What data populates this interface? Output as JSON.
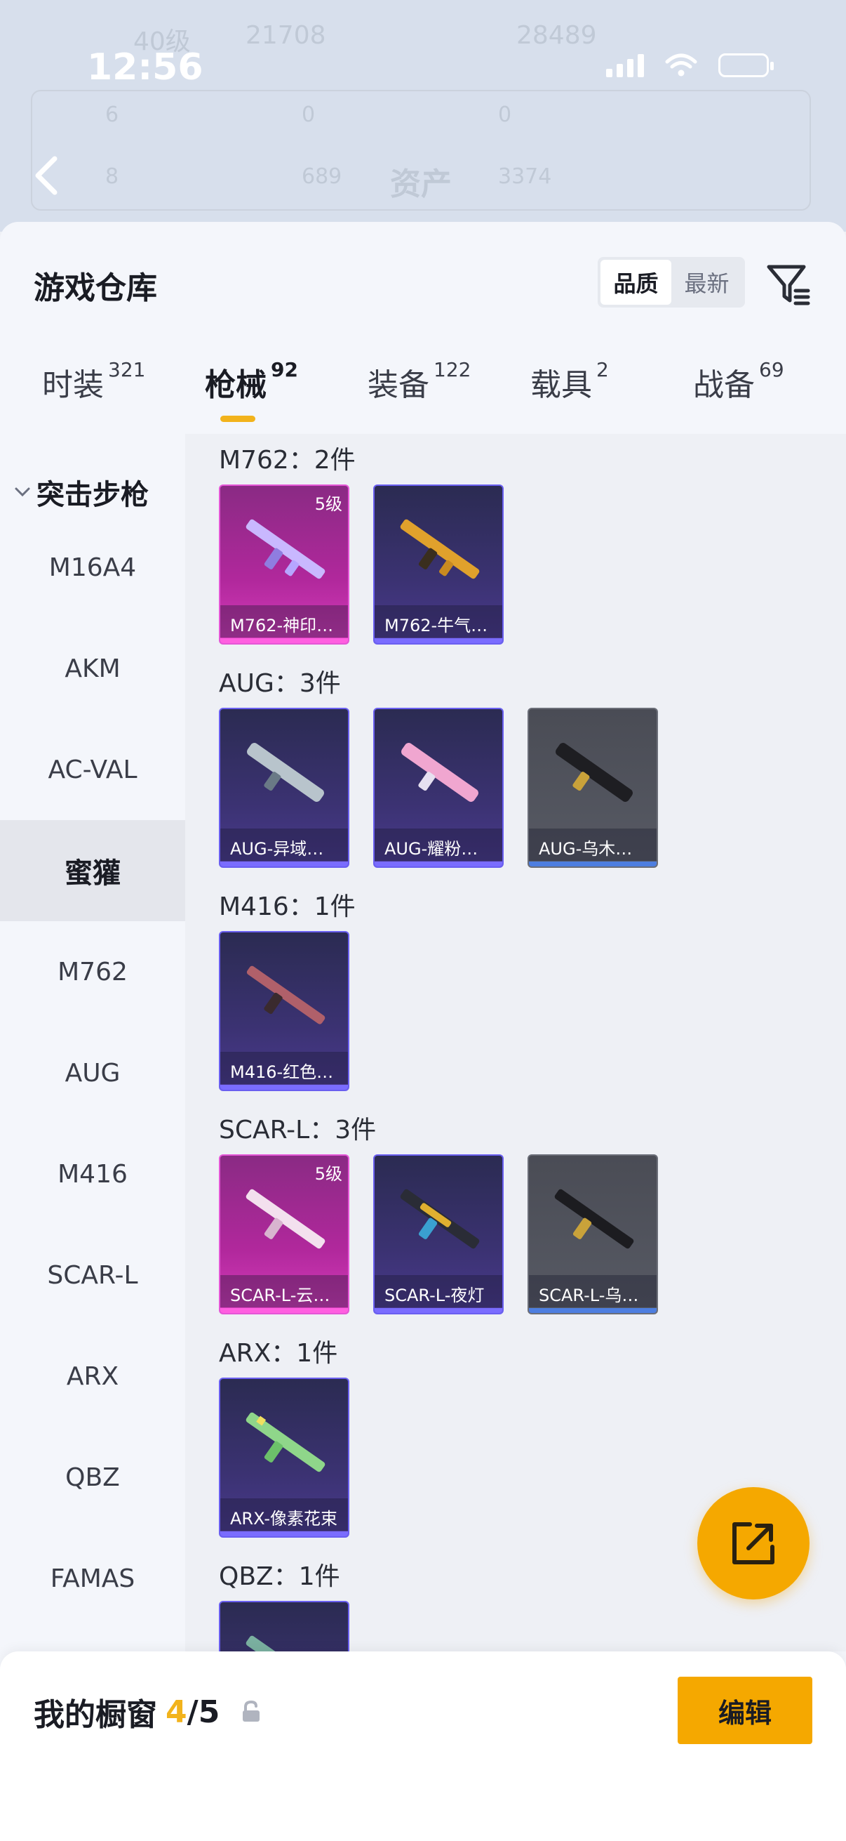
{
  "status": {
    "time": "12:56"
  },
  "background": {
    "ghost_level": "40级",
    "ghost_views": "21708",
    "ghost_score": "28489",
    "ghost_row1": [
      "6",
      "0",
      "0"
    ],
    "ghost_row2": [
      "8",
      "689",
      "3374"
    ],
    "ghost_title": "资产"
  },
  "sheet": {
    "title": "游戏仓库",
    "sort_options": [
      "品质",
      "最新"
    ],
    "active_sort": "品质"
  },
  "tabs": [
    {
      "label": "时装",
      "count": "321"
    },
    {
      "label": "枪械",
      "count": "92"
    },
    {
      "label": "装备",
      "count": "122"
    },
    {
      "label": "载具",
      "count": "2"
    },
    {
      "label": "战备",
      "count": "69"
    }
  ],
  "active_tab": "枪械",
  "sidenav": {
    "group": "突击步枪",
    "items": [
      "M16A4",
      "AKM",
      "AC-VAL",
      "蜜獾",
      "M762",
      "AUG",
      "M416",
      "SCAR-L",
      "ARX",
      "QBZ",
      "FAMAS"
    ],
    "active": "蜜獾"
  },
  "groups": [
    {
      "title": "M762：2件",
      "items": [
        {
          "name": "M762-神印…",
          "rarity": "pink",
          "level": "5级"
        },
        {
          "name": "M762-牛气…",
          "rarity": "purple",
          "level": ""
        }
      ]
    },
    {
      "title": "AUG：3件",
      "items": [
        {
          "name": "AUG-异域银装",
          "rarity": "purple",
          "level": ""
        },
        {
          "name": "AUG-耀粉歌者",
          "rarity": "purple",
          "level": ""
        },
        {
          "name": "AUG-乌木金纹",
          "rarity": "grey",
          "level": ""
        }
      ]
    },
    {
      "title": "M416：1件",
      "items": [
        {
          "name": "M416-红色…",
          "rarity": "purple",
          "level": ""
        }
      ]
    },
    {
      "title": "SCAR-L：3件",
      "items": [
        {
          "name": "SCAR-L-云…",
          "rarity": "pink",
          "level": "5级"
        },
        {
          "name": "SCAR-L-夜灯",
          "rarity": "purple",
          "level": ""
        },
        {
          "name": "SCAR-L-乌…",
          "rarity": "grey",
          "level": ""
        }
      ]
    },
    {
      "title": "ARX：1件",
      "items": [
        {
          "name": "ARX-像素花束",
          "rarity": "purple",
          "level": ""
        }
      ]
    },
    {
      "title": "QBZ：1件",
      "items": [
        {
          "name": "",
          "rarity": "purple",
          "level": ""
        }
      ]
    }
  ],
  "bottom": {
    "title": "我的橱窗",
    "count": "4",
    "total": "/5",
    "edit_label": "编辑"
  },
  "colors": {
    "accent": "#f5a800",
    "tab_underline": "#f2b31c",
    "rarity_pink": "#d63cbc",
    "rarity_purple": "#6a5ff0",
    "rarity_grey": "#575a64"
  },
  "icons": [
    "back-arrow-icon",
    "filter-icon",
    "share-icon",
    "lock-icon",
    "chevron-down-icon"
  ]
}
